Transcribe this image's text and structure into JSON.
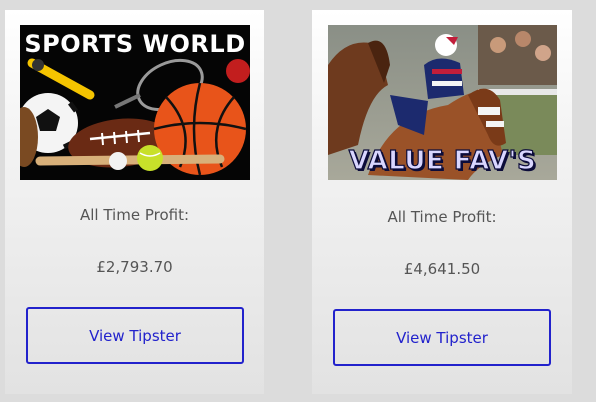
{
  "cards": [
    {
      "image_title": "SPORTS WORLD",
      "profit_label": "All Time Profit:",
      "profit_value": "£2,793.70",
      "button_label": "View Tipster"
    },
    {
      "image_title": "VALUE FAV'S",
      "profit_label": "All Time Profit:",
      "profit_value": "£4,641.50",
      "button_label": "View Tipster"
    }
  ],
  "colors": {
    "page_background": "#dcdcdc",
    "button_accent": "#2222cc",
    "text_muted": "#555555"
  }
}
